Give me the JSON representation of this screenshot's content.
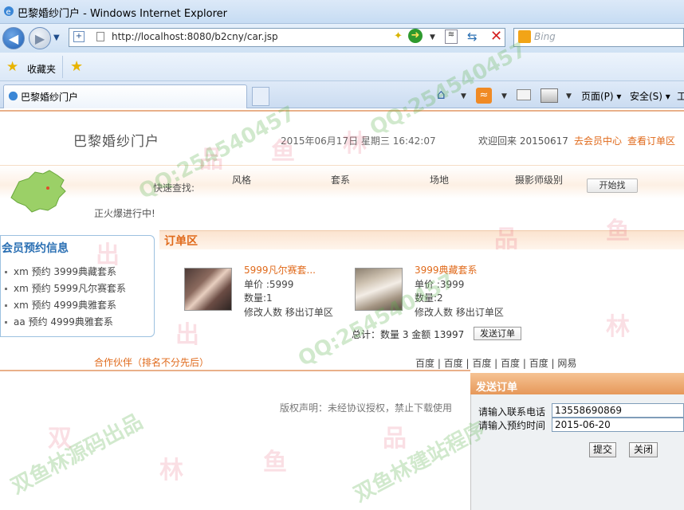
{
  "window": {
    "title": "巴黎婚纱门户 - Windows Internet Explorer"
  },
  "browser": {
    "address": "http://localhost:8080/b2cny/car.jsp",
    "search_placeholder": "Bing",
    "favorites_label": "收藏夹",
    "tab_title": "巴黎婚纱门户",
    "commands": {
      "page": "页面(P) ▾",
      "safety": "安全(S) ▾",
      "tools": "工"
    }
  },
  "header": {
    "site_title": "巴黎婚纱门户",
    "datetime": "2015年06月17日 星期三 16:42:07",
    "welcome": "欢迎回来 20150617",
    "member_center": "去会员中心",
    "view_orders": "查看订单区"
  },
  "quick_search": {
    "label": "快速查找:",
    "items": [
      "风格",
      "套系",
      "场地",
      "摄影师级别"
    ],
    "button": "开始找"
  },
  "marquee": "正火爆进行中!",
  "member_panel": {
    "title": "会员预约信息",
    "items": [
      "xm 预约 3999典藏套系",
      "xm 预约 5999凡尔赛套系",
      "xm 预约 4999典雅套系",
      "aa 预约 4999典雅套系"
    ]
  },
  "order_area": {
    "title": "订单区",
    "products": [
      {
        "name": "5999凡尔赛套...",
        "price": "单价 :5999",
        "qty": "数量:1",
        "actions": "修改人数 移出订单区"
      },
      {
        "name": "3999典藏套系",
        "price": "单价 :3999",
        "qty": "数量:2",
        "actions": "修改人数 移出订单区"
      }
    ],
    "total": "总计：数量  3  金额  13997",
    "send_button": "发送订单"
  },
  "partners": "合作伙伴（排名不分先后）",
  "links": "百度 | 百度 | 百度 | 百度 | 百度 | 网易",
  "copyright": "版权声明：未经协议授权，禁止下载使用",
  "dialog": {
    "title": "发送订单",
    "phone_label": "请输入联系电话",
    "phone_value": "13558690869",
    "date_label": "请输入预约时间",
    "date_value": "2015-06-20",
    "submit": "提交",
    "close": "关闭"
  },
  "watermark": {
    "qq": "QQ:254540457",
    "brand": "双鱼林源码出品",
    "brand2": "双鱼林建站程序"
  }
}
